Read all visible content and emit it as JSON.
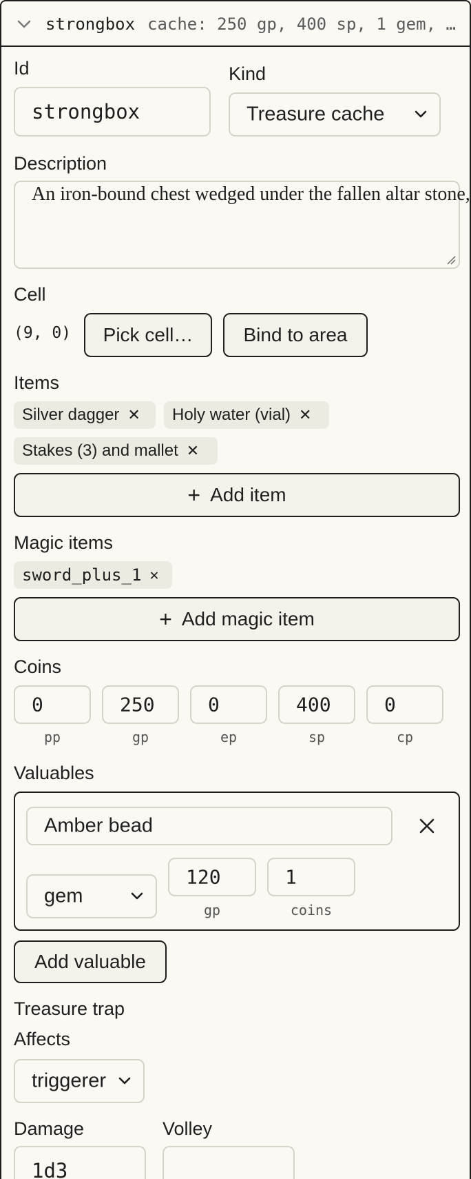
{
  "header": {
    "name": "strongbox",
    "summary": "cache: 250 gp, 400 sp, 1 gem, …"
  },
  "id_field": {
    "label": "Id",
    "value": "strongbox"
  },
  "kind_field": {
    "label": "Kind",
    "value": "Treasure cache"
  },
  "description": {
    "label": "Description",
    "value": "An iron-bound chest wedged under the fallen altar stone, its lid crusted shut."
  },
  "cell": {
    "label": "Cell",
    "value": "(9, 0)",
    "pick_label": "Pick cell…",
    "bind_label": "Bind to area"
  },
  "items": {
    "label": "Items",
    "chips": [
      "Silver dagger",
      "Holy water (vial)",
      "Stakes (3) and mallet"
    ],
    "add_label": "Add item"
  },
  "magic_items": {
    "label": "Magic items",
    "chips": [
      "sword_plus_1"
    ],
    "add_label": "Add magic item"
  },
  "coins": {
    "label": "Coins",
    "entries": [
      {
        "value": "0",
        "unit": "pp"
      },
      {
        "value": "250",
        "unit": "gp"
      },
      {
        "value": "0",
        "unit": "ep"
      },
      {
        "value": "400",
        "unit": "sp"
      },
      {
        "value": "0",
        "unit": "cp"
      }
    ]
  },
  "valuables": {
    "label": "Valuables",
    "entries": [
      {
        "name": "Amber bead",
        "type": "gem",
        "value": "120",
        "value_unit": "gp",
        "count": "1",
        "count_unit": "coins"
      }
    ],
    "add_label": "Add valuable"
  },
  "trap": {
    "heading": "Treasure trap",
    "affects_label": "Affects",
    "affects_value": "triggerer",
    "damage_label": "Damage",
    "damage_value": "1d3",
    "volley_label": "Volley",
    "volley_value": ""
  },
  "icons": {
    "chevron": "chevron-down-icon",
    "remove": "close-icon",
    "add": "plus-icon"
  }
}
